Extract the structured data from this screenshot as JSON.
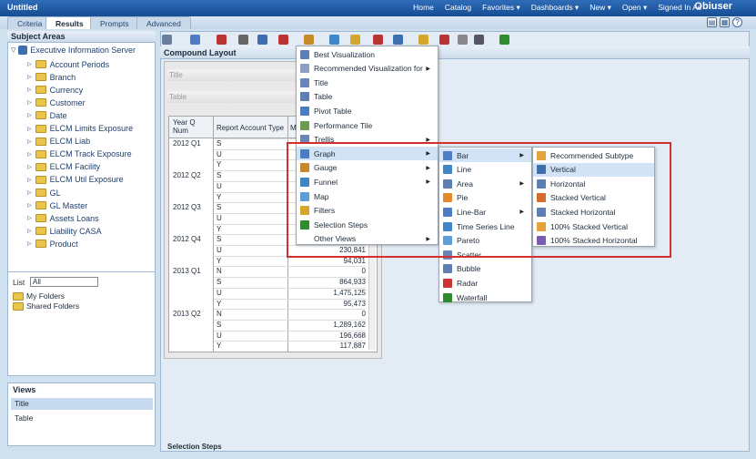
{
  "app_title": "Untitled",
  "topnav": [
    "Home",
    "Catalog",
    "Favorites ▾",
    "Dashboards ▾",
    "New ▾",
    "Open ▾",
    "Signed In As"
  ],
  "user": "Obiuser",
  "tabs": [
    "Criteria",
    "Results",
    "Prompts",
    "Advanced"
  ],
  "subject_areas": {
    "title": "Subject Areas",
    "root": "Executive Information Server",
    "items": [
      "Account Periods",
      "Branch",
      "Currency",
      "Customer",
      "Date",
      "ELCM Limits Exposure",
      "ELCM Liab",
      "ELCM Track Exposure",
      "ELCM Facility",
      "ELCM Util Exposure",
      "GL",
      "GL Master",
      "Assets Loans",
      "Liability CASA",
      "Product"
    ]
  },
  "catalog": {
    "list_label": "List",
    "list_value": "All",
    "items": [
      "My Folders",
      "Shared Folders"
    ]
  },
  "views": {
    "title": "Views",
    "items": [
      "Title",
      "Table"
    ]
  },
  "compound_layout": "Compound Layout",
  "placeholders": [
    "Title",
    "Table"
  ],
  "table": {
    "headers": [
      "Year Q Num",
      "Report Account Type",
      "M"
    ],
    "rows": [
      {
        "q": "2012 Q1",
        "t": "S",
        "v": ""
      },
      {
        "q": "",
        "t": "U",
        "v": ""
      },
      {
        "q": "",
        "t": "Y",
        "v": ""
      },
      {
        "q": "2012 Q2",
        "t": "S",
        "v": ""
      },
      {
        "q": "",
        "t": "U",
        "v": ""
      },
      {
        "q": "",
        "t": "Y",
        "v": ""
      },
      {
        "q": "2012 Q3",
        "t": "S",
        "v": ""
      },
      {
        "q": "",
        "t": "U",
        "v": ""
      },
      {
        "q": "",
        "t": "Y",
        "v": ""
      },
      {
        "q": "2012 Q4",
        "t": "S",
        "v": ""
      },
      {
        "q": "",
        "t": "U",
        "v": "230,841"
      },
      {
        "q": "",
        "t": "Y",
        "v": "94,031"
      },
      {
        "q": "2013 Q1",
        "t": "N",
        "v": "0"
      },
      {
        "q": "",
        "t": "S",
        "v": "864,933"
      },
      {
        "q": "",
        "t": "U",
        "v": "1,475,125"
      },
      {
        "q": "",
        "t": "Y",
        "v": "95,473"
      },
      {
        "q": "2013 Q2",
        "t": "N",
        "v": "0"
      },
      {
        "q": "",
        "t": "S",
        "v": "1,289,162"
      },
      {
        "q": "",
        "t": "U",
        "v": "196,668"
      },
      {
        "q": "",
        "t": "Y",
        "v": "117,887"
      }
    ]
  },
  "menu1": [
    "Best Visualization",
    "Recommended Visualization for",
    "Title",
    "Table",
    "Pivot Table",
    "Performance Tile",
    "Trellis",
    "Graph",
    "Gauge",
    "Funnel",
    "Map",
    "Filters",
    "Selection Steps",
    "Other Views"
  ],
  "menu2": [
    "Bar",
    "Line",
    "Area",
    "Pie",
    "Line-Bar",
    "Time Series Line",
    "Pareto",
    "Scatter",
    "Bubble",
    "Radar",
    "Waterfall"
  ],
  "menu3": [
    "Recommended Subtype",
    "Vertical",
    "Horizontal",
    "Stacked Vertical",
    "Stacked Horizontal",
    "100% Stacked Vertical",
    "100% Stacked Horizontal"
  ],
  "bottom": "Selection Steps",
  "colors": {
    "highlight": "#d2e3f6",
    "red_box": "#d32f2f",
    "top_bar": "#1f5aa6"
  }
}
